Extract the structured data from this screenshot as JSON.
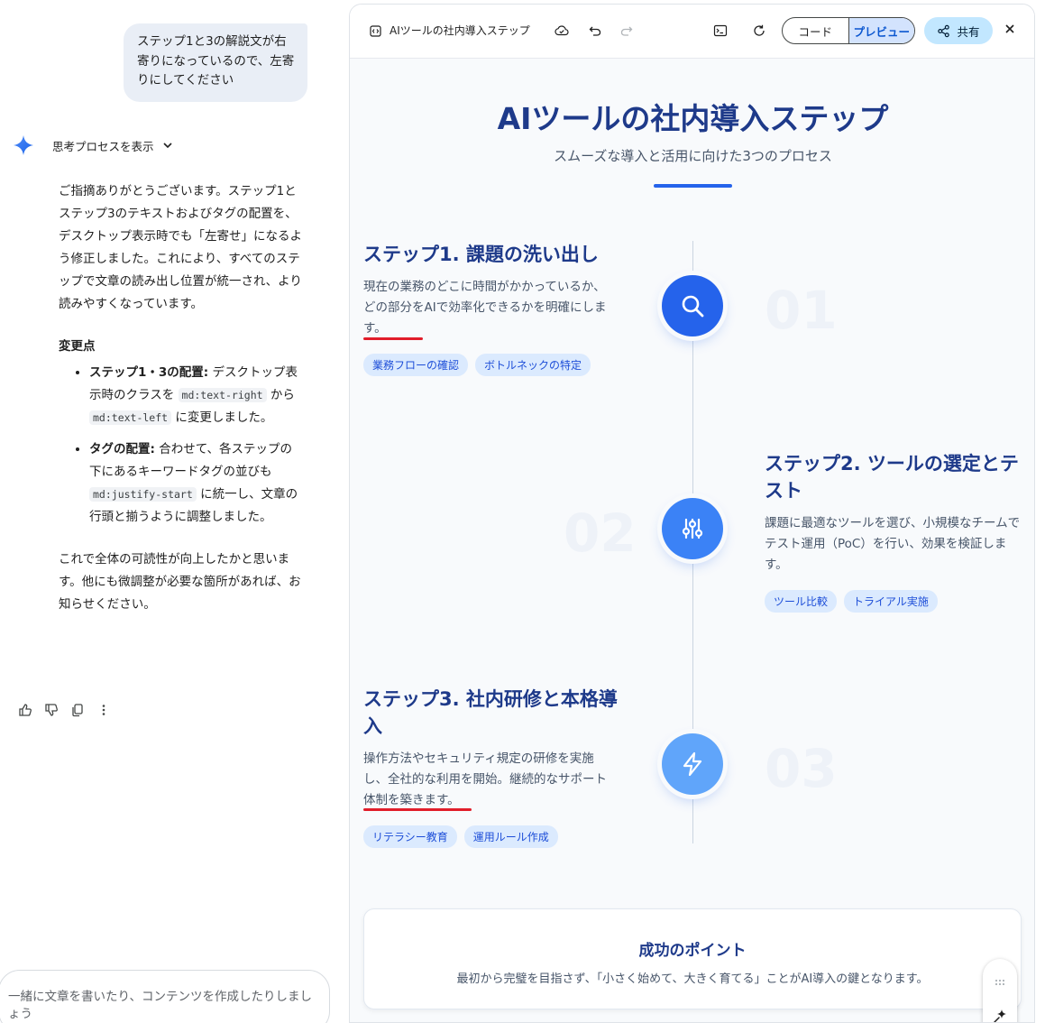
{
  "chat": {
    "user_message": "ステップ1と3の解説文が右寄りになっているので、左寄りにしてください",
    "thinking_label": "思考プロセスを表示",
    "answer_intro": "ご指摘ありがとうございます。ステップ1とステップ3のテキストおよびタグの配置を、デスクトップ表示時でも「左寄せ」になるよう修正しました。これにより、すべてのステップで文章の読み出し位置が統一され、より読みやすくなっています。",
    "changes_heading": "変更点",
    "change1_title": "ステップ1・3の配置:",
    "change1_a": " デスクトップ表示時のクラスを ",
    "change1_code1": "md:text-right",
    "change1_b": " から ",
    "change1_code2": "md:text-left",
    "change1_c": " に変更しました。",
    "change2_title": "タグの配置:",
    "change2_a": " 合わせて、各ステップの下にあるキーワードタグの並びも ",
    "change2_code": "md:justify-start",
    "change2_b": " に統一し、文章の行頭と揃うように調整しました。",
    "answer_outro": "これで全体の可読性が向上したかと思います。他にも微調整が必要な箇所があれば、お知らせください。",
    "composer_placeholder": "一緒に文章を書いたり、コンテンツを作成したりしましょう"
  },
  "canvas": {
    "title": "AIツールの社内導入ステップ",
    "tab_code": "コード",
    "tab_preview": "プレビュー",
    "share_label": "共有",
    "accent": "#2563eb"
  },
  "page": {
    "title": "AIツールの社内導入ステップ",
    "subtitle": "スムーズな導入と活用に向けた3つのプロセス",
    "steps": [
      {
        "number": "01",
        "title": "ステップ1. 課題の洗い出し",
        "desc": "現在の業務のどこに時間がかかっているか、どの部分をAIで効率化できるかを明確にします。",
        "tags": [
          "業務フローの確認",
          "ボトルネックの特定"
        ],
        "icon": "search-icon"
      },
      {
        "number": "02",
        "title": "ステップ2. ツールの選定とテスト",
        "desc": "課題に最適なツールを選び、小規模なチームでテスト運用（PoC）を行い、効果を検証します。",
        "tags": [
          "ツール比較",
          "トライアル実施"
        ],
        "icon": "sliders-icon"
      },
      {
        "number": "03",
        "title": "ステップ3. 社内研修と本格導入",
        "desc": "操作方法やセキュリティ規定の研修を実施し、全社的な利用を開始。継続的なサポート体制を築きます。",
        "tags": [
          "リテラシー教育",
          "運用ルール作成"
        ],
        "icon": "lightning-icon"
      }
    ],
    "point_title": "成功のポイント",
    "point_desc": "最初から完璧を目指さず、「小さく始めて、大きく育てる」ことがAI導入の鍵となります。"
  }
}
